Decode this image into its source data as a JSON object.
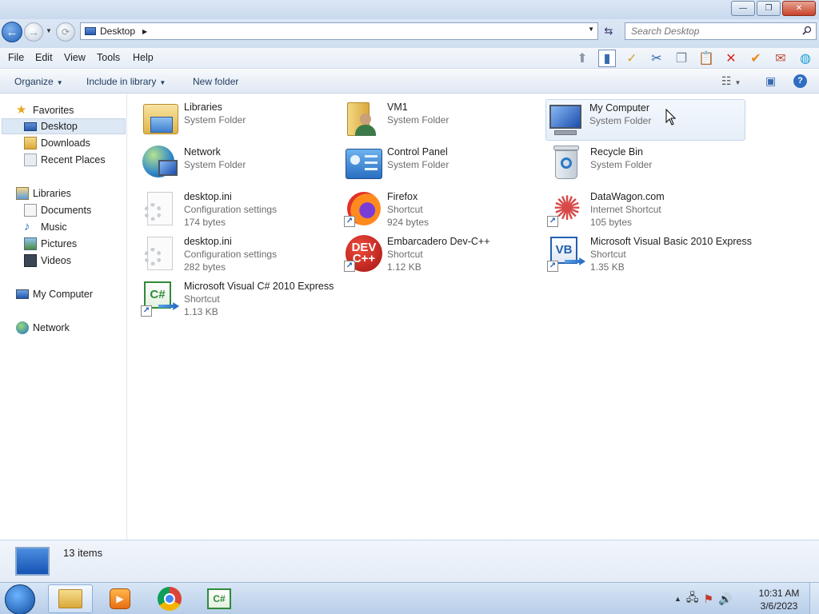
{
  "window": {
    "minimize_glyph": "—",
    "maximize_glyph": "❐",
    "close_glyph": "✕"
  },
  "address": {
    "location": "Desktop",
    "search_placeholder": "Search Desktop"
  },
  "menubar": {
    "items": [
      "File",
      "Edit",
      "View",
      "Tools",
      "Help"
    ]
  },
  "commandbar": {
    "organize": "Organize",
    "include_in_library": "Include in library",
    "new_folder": "New folder"
  },
  "navpane": {
    "favorites": "Favorites",
    "desktop": "Desktop",
    "downloads": "Downloads",
    "recent_places": "Recent Places",
    "libraries": "Libraries",
    "documents": "Documents",
    "music": "Music",
    "pictures": "Pictures",
    "videos": "Videos",
    "my_computer": "My Computer",
    "network": "Network"
  },
  "items": [
    {
      "name": "Libraries",
      "type": "System Folder",
      "size": "",
      "icon": "libraries-icon"
    },
    {
      "name": "VM1",
      "type": "System Folder",
      "size": "",
      "icon": "user-folder-icon"
    },
    {
      "name": "My Computer",
      "type": "System Folder",
      "size": "",
      "icon": "computer-icon"
    },
    {
      "name": "Network",
      "type": "System Folder",
      "size": "",
      "icon": "network-icon"
    },
    {
      "name": "Control Panel",
      "type": "System Folder",
      "size": "",
      "icon": "control-panel-icon"
    },
    {
      "name": "Recycle Bin",
      "type": "System Folder",
      "size": "",
      "icon": "recycle-bin-icon"
    },
    {
      "name": "desktop.ini",
      "type": "Configuration settings",
      "size": "174 bytes",
      "icon": "settings-file-icon"
    },
    {
      "name": "Firefox",
      "type": "Shortcut",
      "size": "924 bytes",
      "icon": "firefox-icon"
    },
    {
      "name": "DataWagon.com",
      "type": "Internet Shortcut",
      "size": "105 bytes",
      "icon": "web-shortcut-icon"
    },
    {
      "name": "desktop.ini",
      "type": "Configuration settings",
      "size": "282 bytes",
      "icon": "settings-file-icon"
    },
    {
      "name": "Embarcadero Dev-C++",
      "type": "Shortcut",
      "size": "1.12 KB",
      "icon": "devcpp-icon"
    },
    {
      "name": "Microsoft Visual Basic 2010 Express",
      "type": "Shortcut",
      "size": "1.35 KB",
      "icon": "vb-icon"
    },
    {
      "name": "Microsoft Visual C# 2010 Express",
      "type": "Shortcut",
      "size": "1.13 KB",
      "icon": "csharp-icon"
    }
  ],
  "details": {
    "count": "13 items"
  },
  "taskbar": {
    "time": "10:31 AM",
    "date": "3/6/2023"
  }
}
